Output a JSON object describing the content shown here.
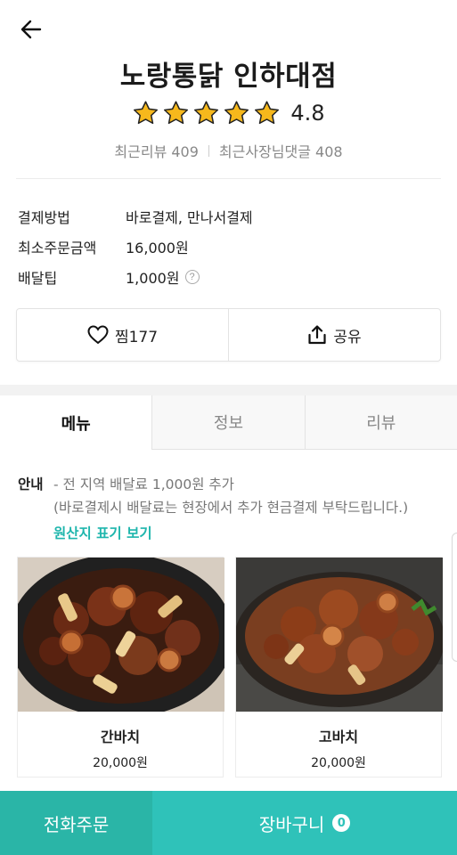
{
  "header": {
    "back_icon": "arrow-left-icon"
  },
  "store": {
    "name": "노랑통닭 인하대점",
    "rating": "4.8",
    "stars": 5,
    "star_color": "#f6b81c",
    "recent_reviews": "최근리뷰 409",
    "owner_replies": "최근사장님댓글 408"
  },
  "info": {
    "rows": [
      {
        "label": "결제방법",
        "value": "바로결제, 만나서결제"
      },
      {
        "label": "최소주문금액",
        "value": "16,000원"
      },
      {
        "label": "배달팁",
        "value": "1,000원"
      }
    ],
    "help_glyph": "?"
  },
  "actions": {
    "favorite_label": "찜177",
    "favorite_icon": "heart-icon",
    "share_label": "공유",
    "share_icon": "share-icon"
  },
  "tabs": [
    {
      "label": "메뉴",
      "active": true
    },
    {
      "label": "정보",
      "active": false
    },
    {
      "label": "리뷰",
      "active": false
    }
  ],
  "notice": {
    "label": "안내",
    "line1": "- 전 지역 배달료 1,000원 추가",
    "line2": "(바로결제시 배달료는 현장에서 추가 현금결제 부탁드립니다.)",
    "origin_link": "원산지 표기 보기"
  },
  "menu_items": [
    {
      "name": "간바치",
      "price": "20,000원"
    },
    {
      "name": "고바치",
      "price": "20,000원"
    }
  ],
  "bottom_bar": {
    "phone_order": "전화주문",
    "cart_label": "장바구니",
    "cart_count": "0"
  },
  "colors": {
    "accent": "#2fc2b9",
    "accent_dark": "#2ab5a7",
    "link": "#1fb6ad"
  }
}
